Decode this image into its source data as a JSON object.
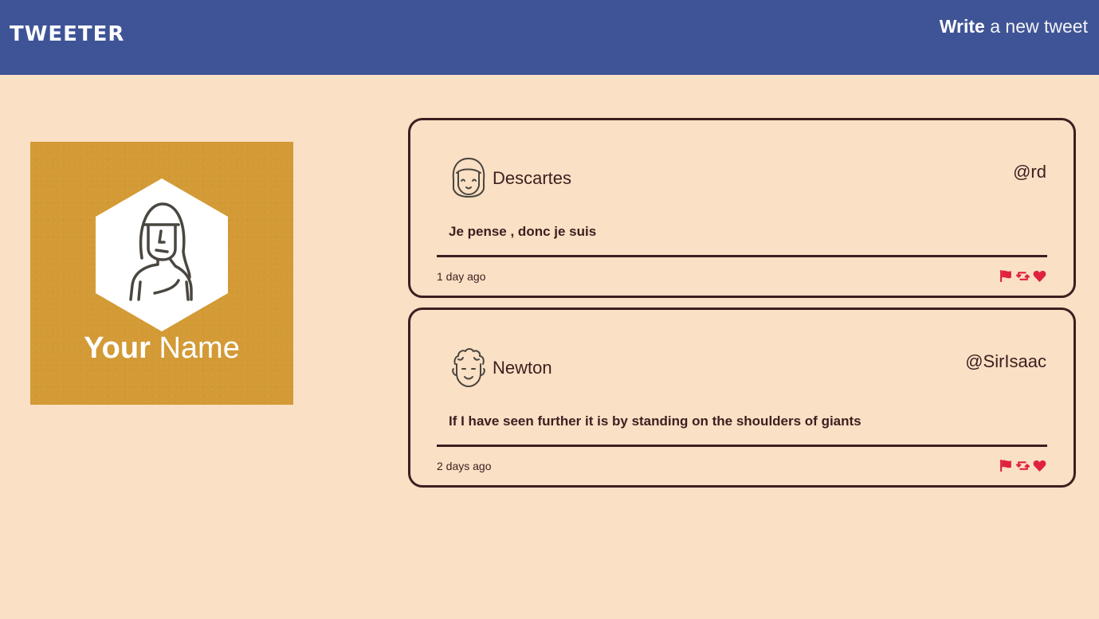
{
  "header": {
    "brand": "TWEETER",
    "compose_bold": "Write",
    "compose_rest": " a new tweet"
  },
  "profile": {
    "first_name": "Your",
    "last_name": " Name",
    "background_color": "#d39a35"
  },
  "tweets": [
    {
      "author": "Descartes",
      "handle": "@rd",
      "text": "Je pense , donc je suis",
      "time": "1 day ago",
      "avatar_icon": "girl-avatar-icon"
    },
    {
      "author": "Newton",
      "handle": "@SirIsaac",
      "text": "If I have seen further it is by standing on the shoulders of giants",
      "time": "2 days ago",
      "avatar_icon": "curly-hair-avatar-icon"
    }
  ],
  "actions": [
    "flag-icon",
    "retweet-icon",
    "heart-icon"
  ],
  "colors": {
    "nav": "#3e5496",
    "page_bg": "#fae0c4",
    "ink": "#3b1f20",
    "action": "#e0223f"
  }
}
